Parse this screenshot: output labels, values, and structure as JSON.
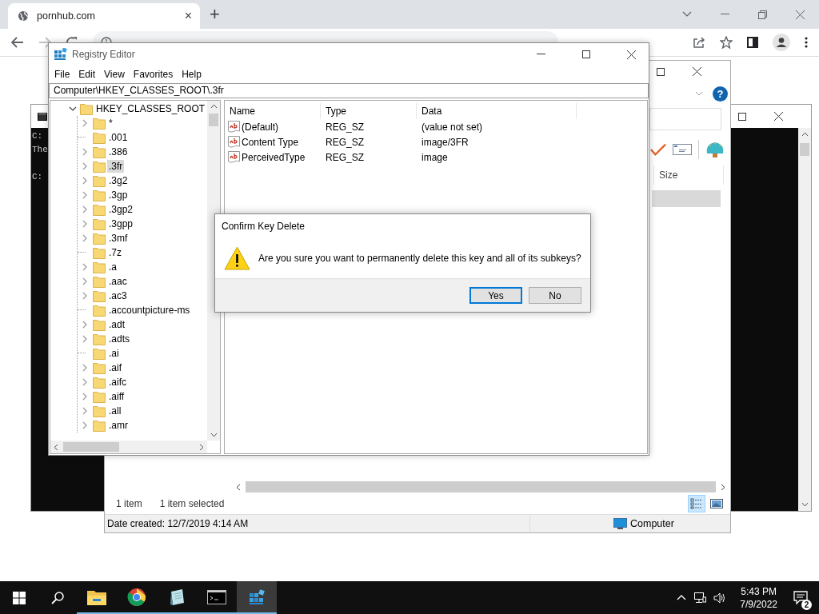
{
  "browser": {
    "tab": {
      "title": "pornhub.com",
      "close": "×"
    },
    "new_tab": "+"
  },
  "console": {
    "lines": [
      "C:",
      "The",
      "C:"
    ]
  },
  "explorer": {
    "help": "?",
    "columns": [
      "Size"
    ],
    "status": [
      "1 item",
      "1 item selected"
    ],
    "views": [
      {
        "kind": "details",
        "selected": true
      },
      {
        "kind": "preview",
        "selected": false
      }
    ],
    "details": "Date created: 12/7/2019 4:14 AM",
    "location": "Computer"
  },
  "registry_editor": {
    "title": "Registry Editor",
    "menu": [
      "File",
      "Edit",
      "View",
      "Favorites",
      "Help"
    ],
    "address": "Computer\\HKEY_CLASSES_ROOT\\.3fr",
    "tree": [
      {
        "label": "HKEY_CLASSES_ROOT",
        "expanded": true,
        "children": [
          {
            "label": "*",
            "expandable": true,
            "selected": false
          },
          {
            "label": ".001",
            "expandable": false,
            "selected": false
          },
          {
            "label": ".386",
            "expandable": true,
            "selected": false
          },
          {
            "label": ".3fr",
            "expandable": true,
            "selected": true
          },
          {
            "label": ".3g2",
            "expandable": true,
            "selected": false
          },
          {
            "label": ".3gp",
            "expandable": true,
            "selected": false
          },
          {
            "label": ".3gp2",
            "expandable": true,
            "selected": false
          },
          {
            "label": ".3gpp",
            "expandable": true,
            "selected": false
          },
          {
            "label": ".3mf",
            "expandable": true,
            "selected": false
          },
          {
            "label": ".7z",
            "expandable": false,
            "selected": false
          },
          {
            "label": ".a",
            "expandable": true,
            "selected": false
          },
          {
            "label": ".aac",
            "expandable": true,
            "selected": false
          },
          {
            "label": ".ac3",
            "expandable": true,
            "selected": false
          },
          {
            "label": ".accountpicture-ms",
            "expandable": false,
            "selected": false
          },
          {
            "label": ".adt",
            "expandable": true,
            "selected": false
          },
          {
            "label": ".adts",
            "expandable": true,
            "selected": false
          },
          {
            "label": ".ai",
            "expandable": false,
            "selected": false
          },
          {
            "label": ".aif",
            "expandable": true,
            "selected": false
          },
          {
            "label": ".aifc",
            "expandable": true,
            "selected": false
          },
          {
            "label": ".aiff",
            "expandable": true,
            "selected": false
          },
          {
            "label": ".all",
            "expandable": true,
            "selected": false
          },
          {
            "label": ".amr",
            "expandable": true,
            "selected": false
          }
        ]
      }
    ],
    "columns": [
      "Name",
      "Type",
      "Data"
    ],
    "values": [
      {
        "name": "(Default)",
        "type": "REG_SZ",
        "data": "(value not set)"
      },
      {
        "name": "Content Type",
        "type": "REG_SZ",
        "data": "image/3FR"
      },
      {
        "name": "PerceivedType",
        "type": "REG_SZ",
        "data": "image"
      }
    ]
  },
  "dialog": {
    "title": "Confirm Key Delete",
    "message": "Are you sure you want to permanently delete this key and all of its subkeys?",
    "buttons": [
      {
        "label": "Yes",
        "default": true
      },
      {
        "label": "No",
        "default": false
      }
    ]
  },
  "taskbar": {
    "apps": [
      {
        "kind": "explorer",
        "running": true,
        "active": false
      },
      {
        "kind": "chrome",
        "running": true,
        "active": false
      },
      {
        "kind": "notepad",
        "running": true,
        "active": false
      },
      {
        "kind": "cmd",
        "running": true,
        "active": false
      },
      {
        "kind": "regedit",
        "running": true,
        "active": true
      }
    ],
    "time": "5:43 PM",
    "date": "7/9/2022",
    "notifications": "2"
  }
}
